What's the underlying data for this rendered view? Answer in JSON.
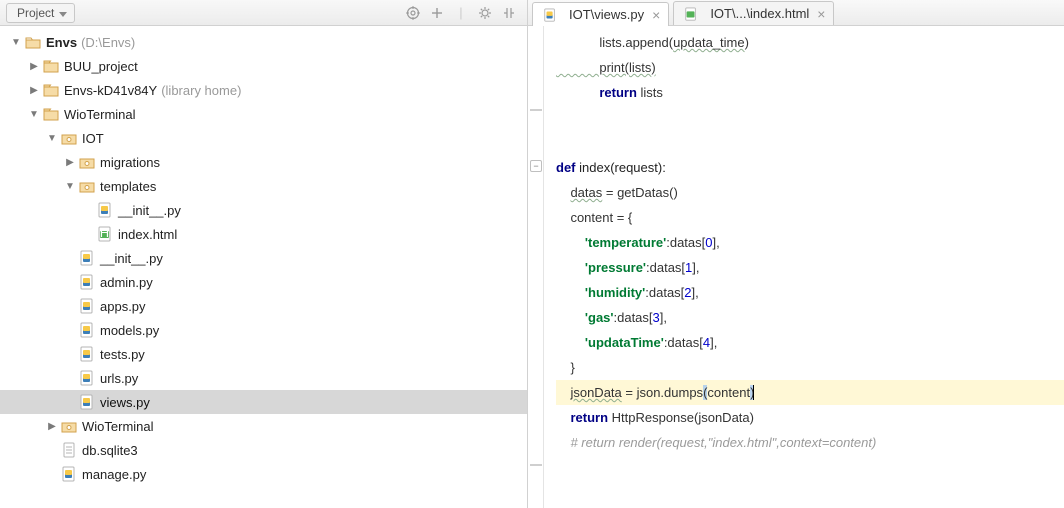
{
  "header": {
    "project_label": "Project"
  },
  "tree": {
    "envs": {
      "name": "Envs",
      "path": "(D:\\Envs)"
    },
    "items": {
      "buu": "BUU_project",
      "envs_k": "Envs-kD41v84Y",
      "envs_k_note": "(library home)",
      "wio": "WioTerminal",
      "iot": "IOT",
      "migrations": "migrations",
      "templates": "templates",
      "init_t": "__init__.py",
      "index_html": "index.html",
      "init": "__init__.py",
      "admin": "admin.py",
      "apps": "apps.py",
      "models": "models.py",
      "tests": "tests.py",
      "urls": "urls.py",
      "views": "views.py",
      "wio2": "WioTerminal",
      "db": "db.sqlite3",
      "manage": "manage.py"
    }
  },
  "tabs": {
    "t0": "IOT\\views.py",
    "t1": "IOT\\...\\index.html"
  },
  "code": {
    "l0": "            lists.append(",
    "l0b": "updata_time",
    "l0c": ")",
    "l1a": "            print(",
    "l1b": "lists",
    "l1c": ")",
    "l2a": "            ",
    "l2kw": "return",
    "l2b": " lists",
    "blank": "",
    "defkw": "def",
    "defn": " index(request):",
    "l6a": "    ",
    "l6b": "datas",
    "l6c": " = getDatas()",
    "l7a": "    content = {",
    "l8a": "        ",
    "l8s": "'temperature'",
    "l8b": ":datas[",
    "l8n": "0",
    "l8c": "],",
    "l9s": "'pressure'",
    "l9n": "1",
    "l10s": "'humidity'",
    "l10n": "2",
    "l11s": "'gas'",
    "l11n": "3",
    "l12s": "'updataTime'",
    "l12n": "4",
    "l13": "    }",
    "l14a": "    ",
    "l14b": "jsonData",
    "l14c": " = json.dumps",
    "l14d": "(",
    "l14e": "content",
    "l14f": ")",
    "l15a": "    ",
    "l15kw": "return",
    "l15b": " HttpResponse(jsonData)",
    "l16": "    # return render(request,\"index.html\",context=content)"
  }
}
